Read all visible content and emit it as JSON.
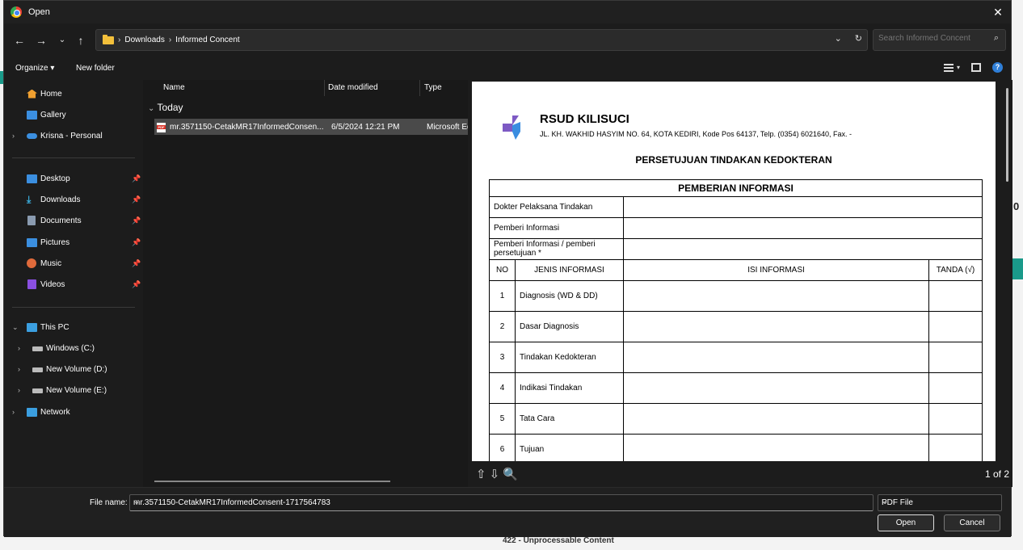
{
  "window": {
    "title": "Open"
  },
  "nav": {
    "breadcrumbs": [
      "Downloads",
      "Informed Concent"
    ],
    "search_placeholder": "Search Informed Concent"
  },
  "toolbar": {
    "organize": "Organize",
    "new_folder": "New folder"
  },
  "sidebar": {
    "quick": [
      {
        "label": "Home",
        "icon": "home-icon",
        "color": "#f0a030"
      },
      {
        "label": "Gallery",
        "icon": "gallery-icon",
        "color": "#3b8fe0"
      },
      {
        "label": "Krisna - Personal",
        "icon": "onedrive-icon",
        "color": "#3b8fe0"
      }
    ],
    "pinned": [
      {
        "label": "Desktop",
        "icon": "desktop-icon",
        "color": "#3b8fe0"
      },
      {
        "label": "Downloads",
        "icon": "downloads-icon",
        "color": "#3bb0e0"
      },
      {
        "label": "Documents",
        "icon": "documents-icon",
        "color": "#8a9bb0"
      },
      {
        "label": "Pictures",
        "icon": "pictures-icon",
        "color": "#3b8fe0"
      },
      {
        "label": "Music",
        "icon": "music-icon",
        "color": "#e06a3b"
      },
      {
        "label": "Videos",
        "icon": "videos-icon",
        "color": "#8a4fe0"
      }
    ],
    "pc": [
      {
        "label": "This PC",
        "icon": "pc-icon",
        "color": "#3b9fe0"
      },
      {
        "label": "Windows (C:)",
        "icon": "drive-icon",
        "color": "#bbbbbb"
      },
      {
        "label": "New Volume (D:)",
        "icon": "drive-icon",
        "color": "#bbbbbb"
      },
      {
        "label": "New Volume (E:)",
        "icon": "drive-icon",
        "color": "#bbbbbb"
      },
      {
        "label": "Network",
        "icon": "network-icon",
        "color": "#3b9fe0"
      }
    ]
  },
  "filelist": {
    "columns": [
      "Name",
      "Date modified",
      "Type"
    ],
    "group": "Today",
    "files": [
      {
        "name": "mr.3571150-CetakMR17InformedConsen...",
        "date": "6/5/2024 12:21 PM",
        "type": "Microsoft Ed"
      }
    ]
  },
  "preview": {
    "hospital": "RSUD KILISUCI",
    "address": "JL. KH. WAKHID HASYIM NO. 64, KOTA KEDIRI, Kode Pos 64137, Telp. (0354) 6021640, Fax. -",
    "title": "PERSETUJUAN TINDAKAN KEDOKTERAN",
    "section": "PEMBERIAN INFORMASI",
    "fields": [
      "Dokter Pelaksana Tindakan",
      "Pemberi Informasi",
      "Pemberi Informasi / pemberi persetujuan *"
    ],
    "headers": [
      "NO",
      "JENIS INFORMASI",
      "ISI INFORMASI",
      "TANDA (√)"
    ],
    "rows": [
      {
        "no": "1",
        "jenis": "Diagnosis (WD & DD)"
      },
      {
        "no": "2",
        "jenis": "Dasar Diagnosis"
      },
      {
        "no": "3",
        "jenis": "Tindakan Kedokteran"
      },
      {
        "no": "4",
        "jenis": "Indikasi Tindakan"
      },
      {
        "no": "5",
        "jenis": "Tata Cara"
      },
      {
        "no": "6",
        "jenis": "Tujuan"
      }
    ],
    "page_count": "1 of 2"
  },
  "footer": {
    "file_name_label": "File name:",
    "file_name": "mr.3571150-CetakMR17InformedConsent-1717564783",
    "file_type": "PDF File",
    "open": "Open",
    "cancel": "Cancel"
  },
  "background": {
    "error_text": "422 - Unprocessable Content",
    "edge_char": "0"
  }
}
